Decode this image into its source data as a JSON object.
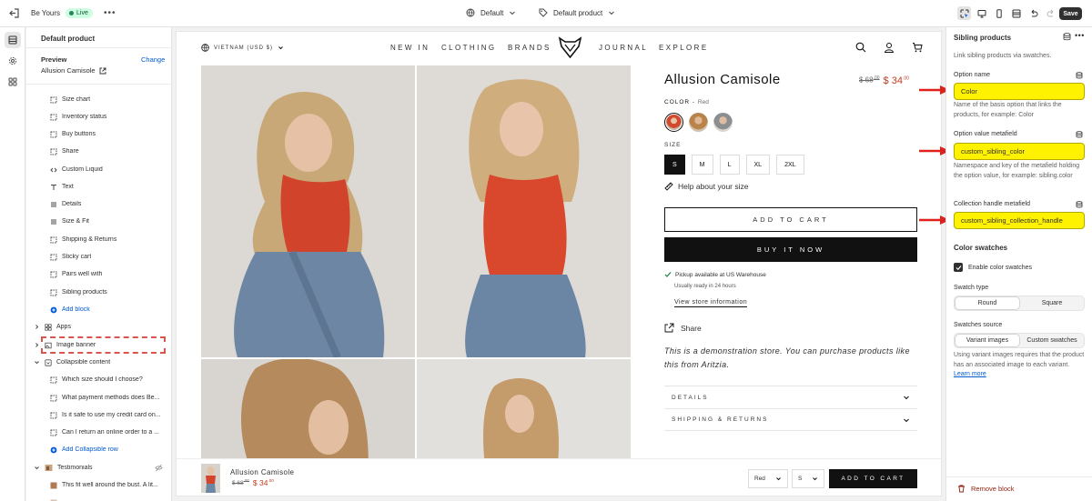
{
  "topbar": {
    "store_name": "Be Yours",
    "status": "Live",
    "more": "•••",
    "theme": "Default",
    "template": "Default product",
    "save_label": "Save"
  },
  "left_panel": {
    "title": "Default product",
    "preview_label": "Preview",
    "change_label": "Change",
    "preview_product": "Allusion Camisole",
    "blocks": [
      {
        "label": "Size chart",
        "icon": "frame-icon"
      },
      {
        "label": "Inventory status",
        "icon": "frame-icon"
      },
      {
        "label": "Buy buttons",
        "icon": "frame-icon"
      },
      {
        "label": "Share",
        "icon": "frame-icon"
      },
      {
        "label": "Custom Liquid",
        "icon": "code-icon"
      },
      {
        "label": "Text",
        "icon": "text-icon"
      },
      {
        "label": "Details",
        "icon": "list-icon"
      },
      {
        "label": "Size & Fit",
        "icon": "list-icon"
      },
      {
        "label": "Shipping & Returns",
        "icon": "frame-icon"
      },
      {
        "label": "Sticky cart",
        "icon": "frame-icon"
      },
      {
        "label": "Pairs well with",
        "icon": "frame-icon"
      },
      {
        "label": "Sibling products",
        "icon": "frame-icon"
      }
    ],
    "add_block": "Add block",
    "sections": {
      "apps": "Apps",
      "image_banner": "Image banner",
      "collapsible": "Collapsible content",
      "testimonials": "Testimonials"
    },
    "collapsible_rows": [
      "Which size should I choose?",
      "What payment methods does Be...",
      "Is it safe to use my credit card on...",
      "Can I return an online order to a ..."
    ],
    "add_collapsible": "Add Collapsible row",
    "testimonial_rows": [
      "This fit well around the bust. A lit..."
    ]
  },
  "storefront": {
    "locale": "VIETNAM (USD $)",
    "nav": [
      "NEW IN",
      "CLOTHING",
      "BRANDS",
      "JOURNAL",
      "EXPLORE"
    ],
    "product_title": "Allusion Camisole",
    "price_old": "$ 68",
    "price_old_cents": ".00",
    "price_new": "$ 34",
    "price_new_cents": ".00",
    "color_label": "COLOR",
    "color_value": "Red",
    "size_label": "SIZE",
    "sizes": [
      "S",
      "M",
      "L",
      "XL",
      "2XL"
    ],
    "selected_size": "S",
    "help_size": "Help about your size",
    "add_to_cart": "ADD TO CART",
    "buy_now": "BUY IT NOW",
    "pickup": "Pickup available at US Warehouse",
    "ready": "Usually ready in 24 hours",
    "view_store": "View store information",
    "share": "Share",
    "demo_text": "This is a demonstration store. You can purchase products like this from Aritzia.",
    "accordions": [
      "DETAILS",
      "SHIPPING & RETURNS"
    ],
    "sticky": {
      "name": "Allusion Camisole",
      "price_old": "$ 68",
      "price_old_cents": ".00",
      "price_new": "$ 34",
      "price_new_cents": ".00",
      "color": "Red",
      "size": "S",
      "button": "ADD TO CART"
    }
  },
  "right_panel": {
    "title": "Sibling products",
    "description": "Link sibling products via swatches.",
    "fields": [
      {
        "label": "Option name",
        "value": "Color",
        "help": "Name of the basis option that links the products, for example: Color"
      },
      {
        "label": "Option value metafield",
        "value": "custom_sibling_color",
        "help": "Namespace and key of the metafield holding the option value, for example: sibling.color"
      },
      {
        "label": "Collection handle metafield",
        "value": "custom_sibling_collection_handle",
        "help": ""
      }
    ],
    "color_swatches_heading": "Color swatches",
    "enable_swatches": "Enable color swatches",
    "swatch_type_label": "Swatch type",
    "swatch_types": [
      "Round",
      "Square"
    ],
    "swatch_source_label": "Swatches source",
    "swatch_sources": [
      "Variant images",
      "Custom swatches"
    ],
    "source_help": "Using variant images requires that the product has an associated image to each variant.",
    "learn_more": "Learn more",
    "remove_block": "Remove block"
  },
  "colors": {
    "highlight": "#fff200",
    "annotation_red": "#e0201b",
    "link_blue": "#005bd3",
    "price_red": "#c23b22"
  }
}
